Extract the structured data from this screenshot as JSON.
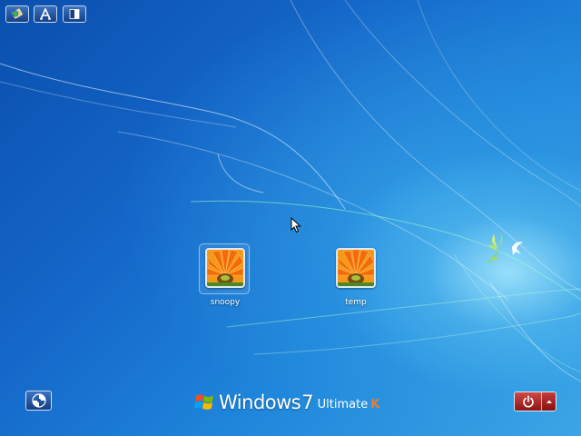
{
  "toolbar": {
    "items": [
      {
        "name": "language-button",
        "icon": "globe-keyboard-icon"
      },
      {
        "name": "font-size-button",
        "icon": "letter-a-icon"
      },
      {
        "name": "high-contrast-button",
        "icon": "contrast-icon"
      }
    ]
  },
  "users": [
    {
      "name": "snoopy",
      "selected": true
    },
    {
      "name": "temp",
      "selected": false
    }
  ],
  "bottom": {
    "ease_of_access_icon": "ease-of-access-icon",
    "brand": {
      "word": "Windows",
      "version": "7",
      "edition": "Ultimate",
      "suffix": "K"
    },
    "power_icon": "power-icon",
    "power_options_icon": "chevron-up-icon"
  },
  "colors": {
    "background_dark": "#0a4fae",
    "background_light": "#3aa6e6",
    "power_red": "#b22a2a",
    "brand_k_orange": "#f07a2a"
  }
}
